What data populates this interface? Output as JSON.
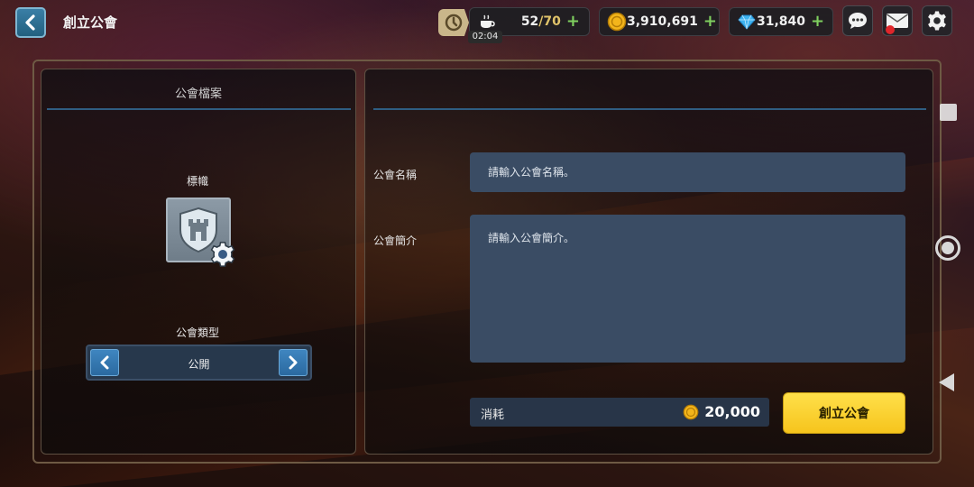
{
  "header": {
    "title": "創立公會"
  },
  "resources": {
    "stamina": {
      "current": "52",
      "max": "/70",
      "timer": "02:04"
    },
    "gold": {
      "value": "3,910,691"
    },
    "gems": {
      "value": "31,840"
    },
    "plus_symbol": "+"
  },
  "left_panel": {
    "title": "公會檔案",
    "emblem_label": "標幟",
    "guild_type_label": "公會類型",
    "guild_type_value": "公開"
  },
  "form": {
    "name_label": "公會名稱",
    "name_placeholder": "請輸入公會名稱。",
    "intro_label": "公會簡介",
    "intro_placeholder": "請輸入公會簡介。"
  },
  "cost": {
    "label": "消耗",
    "amount": "20,000"
  },
  "actions": {
    "create_label": "創立公會"
  },
  "colors": {
    "accent_yellow": "#f6c41c",
    "input_bg": "#3a4c64",
    "divider_blue": "#2f5d82",
    "notification_red": "#e0262b"
  },
  "icons": [
    "back-arrow-icon",
    "stamina-clock-icon",
    "coffee-cup-icon",
    "gold-coin-icon",
    "diamond-icon",
    "chat-icon",
    "mail-icon",
    "settings-gear-icon",
    "shield-tower-icon",
    "emblem-gear-icon"
  ]
}
